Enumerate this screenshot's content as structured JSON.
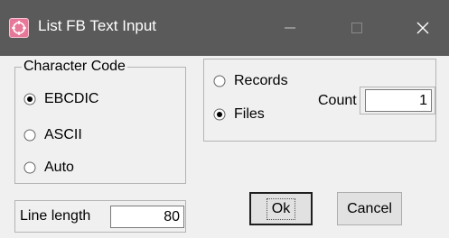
{
  "window": {
    "title": "List FB Text Input",
    "icon": "app-icon",
    "controls": {
      "minimize": "minimize-icon",
      "maximize": "maximize-icon",
      "close": "close-icon"
    }
  },
  "character_code": {
    "label": "Character Code",
    "options": [
      {
        "label": "EBCDIC",
        "selected": true
      },
      {
        "label": "ASCII",
        "selected": false
      },
      {
        "label": "Auto",
        "selected": false
      }
    ]
  },
  "output": {
    "options": [
      {
        "label": "Records",
        "selected": false
      },
      {
        "label": "Files",
        "selected": true
      }
    ],
    "count_label": "Count",
    "count_value": "1"
  },
  "line_length": {
    "label": "Line length",
    "value": "80"
  },
  "buttons": {
    "ok": "Ok",
    "cancel": "Cancel"
  }
}
